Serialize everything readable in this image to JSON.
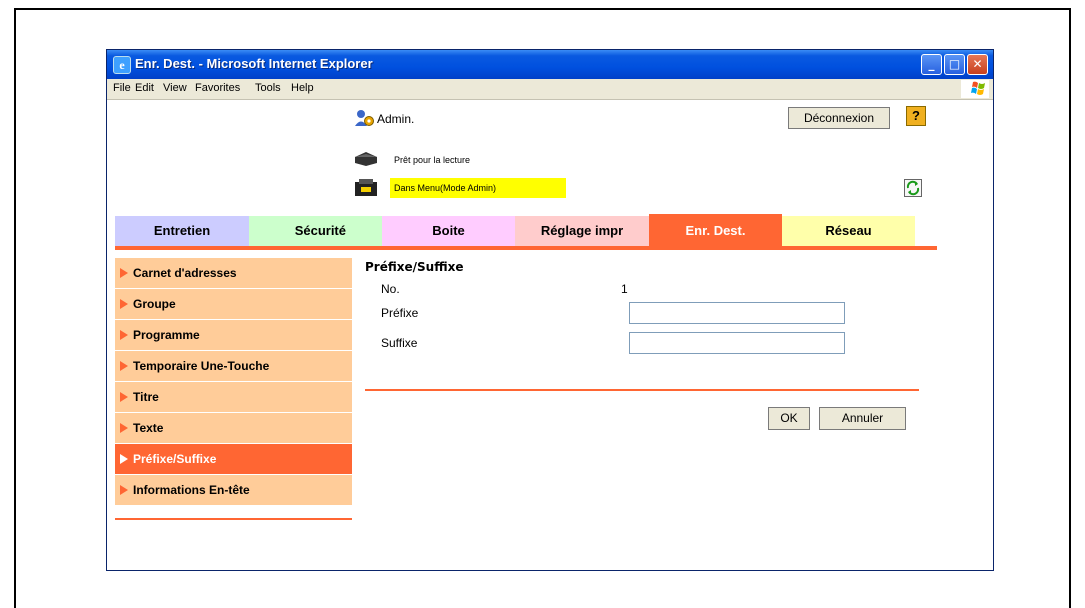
{
  "window": {
    "title": "Enr. Dest. - Microsoft Internet Explorer",
    "controls": {
      "minimize": "_",
      "maximize": "□",
      "close": "✕"
    }
  },
  "menu": {
    "items": [
      "File",
      "Edit",
      "View",
      "Favorites",
      "Tools",
      "Help"
    ]
  },
  "header": {
    "user_label": "Admin.",
    "logout_label": "Déconnexion",
    "help_label": "?",
    "status_ready": "Prêt pour la lecture",
    "status_mode": "Dans Menu(Mode Admin)"
  },
  "tabs": [
    {
      "label": "Entretien",
      "color": "#ccccff"
    },
    {
      "label": "Sécurité",
      "color": "#ccffcc"
    },
    {
      "label": "Boite",
      "color": "#ffccff"
    },
    {
      "label": "Réglage impr",
      "color": "#ffcccc"
    },
    {
      "label": "Enr. Dest.",
      "color": "#ff6633",
      "active": true
    },
    {
      "label": "Réseau",
      "color": "#ffffaa"
    }
  ],
  "sidebar": {
    "items": [
      {
        "label": "Carnet d'adresses"
      },
      {
        "label": "Groupe"
      },
      {
        "label": "Programme"
      },
      {
        "label": "Temporaire Une-Touche"
      },
      {
        "label": "Titre"
      },
      {
        "label": "Texte"
      },
      {
        "label": "Préfixe/Suffixe",
        "active": true
      },
      {
        "label": "Informations En-tête"
      }
    ]
  },
  "form": {
    "title": "Préfixe/Suffixe",
    "no_label": "No.",
    "no_value": "1",
    "prefix_label": "Préfixe",
    "prefix_value": "",
    "suffix_label": "Suffixe",
    "suffix_value": "",
    "ok_label": "OK",
    "cancel_label": "Annuler"
  },
  "colors": {
    "accent": "#ff6633",
    "sidebar_bg": "#ffcc99",
    "titlebar": "#0050df"
  }
}
